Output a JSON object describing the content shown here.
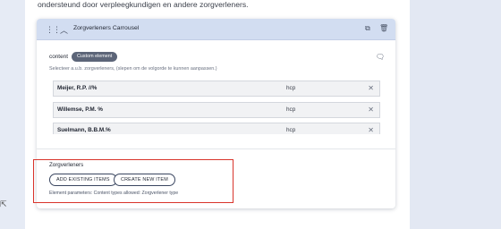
{
  "intro_text": "ondersteund door verpleegkundigen en andere zorgverleners.",
  "card": {
    "title": "Zorgverleners Carrousel",
    "icons": {
      "drag": "drag-handle-icon",
      "collapse": "chevron-up-icon",
      "copy": "copy-icon",
      "delete": "trash-icon",
      "comment": "comment-icon"
    }
  },
  "content": {
    "label": "content",
    "badge": "Custom element",
    "helper": "Selecteer a.u.b. zorgverleners, (slepen om de volgorde te kunnen aanpassen.)",
    "items": [
      {
        "name": "Meijer, R.P. //%",
        "type": "hcp"
      },
      {
        "name": "Willemse, P.M. %",
        "type": "hcp"
      },
      {
        "name": "Suelmann, B.B.M.%",
        "type": "hcp"
      }
    ]
  },
  "footer": {
    "label": "Zorgverleners",
    "add_existing": "ADD EXISTING ITEMS",
    "create_new": "CREATE NEW ITEM",
    "params": "Element parameters: Content types allowed: Zorgverlener type"
  },
  "colors": {
    "highlight": "#d9342b",
    "header_bg": "#d2ddf1",
    "badge_bg": "#5c6578"
  }
}
